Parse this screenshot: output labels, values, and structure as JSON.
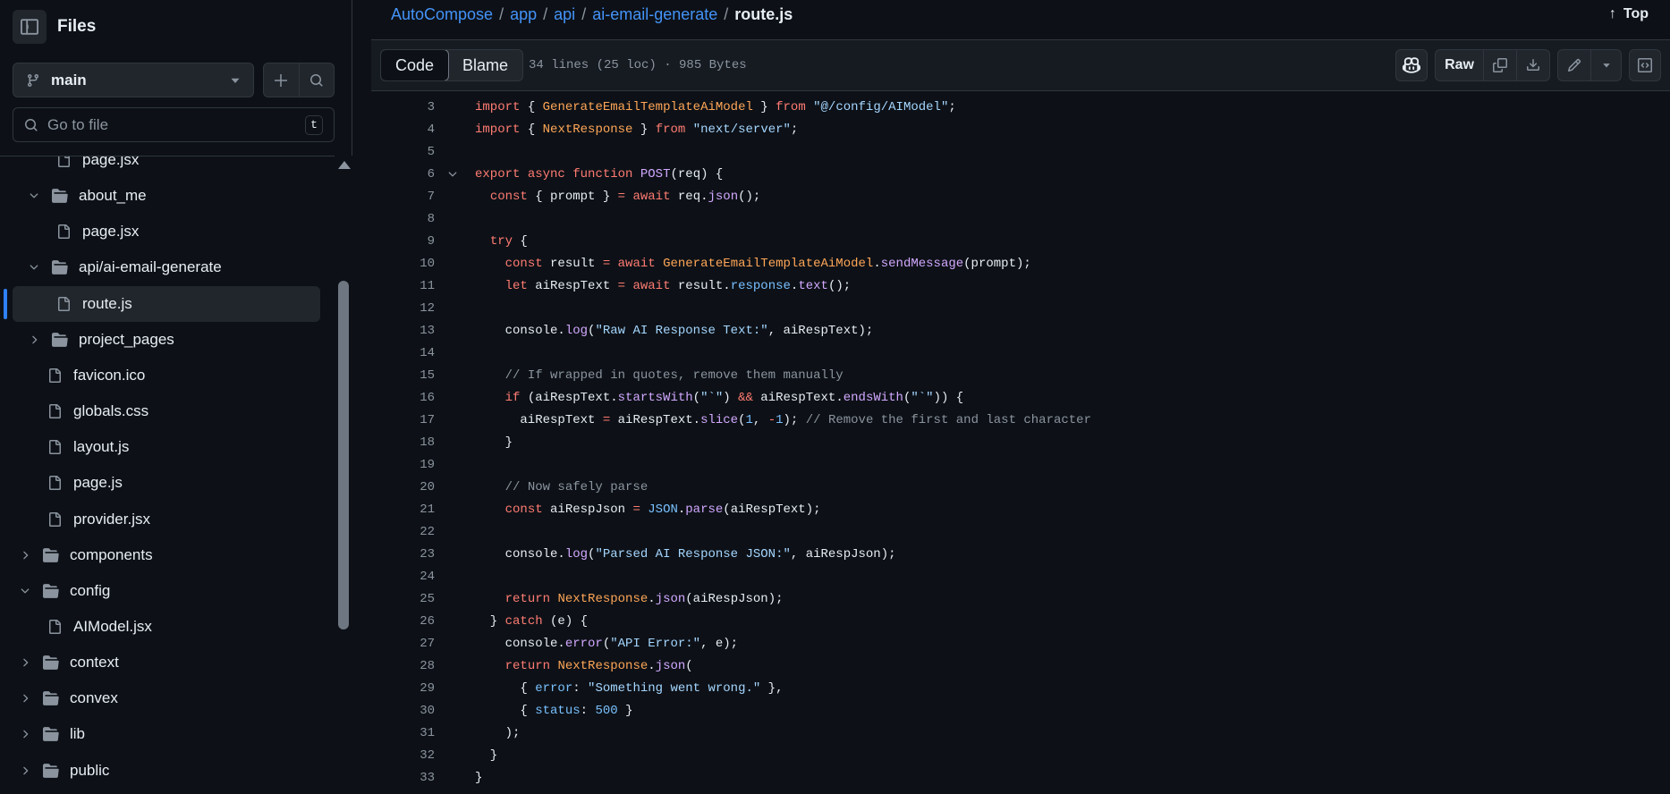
{
  "sidebar": {
    "title": "Files",
    "branch": "main",
    "search_placeholder": "Go to file",
    "search_shortcut": "t",
    "tree": [
      {
        "label": "page.jsx",
        "type": "file",
        "depth": 3
      },
      {
        "label": "about_me",
        "type": "folder-open",
        "depth": 2
      },
      {
        "label": "page.jsx",
        "type": "file",
        "depth": 3
      },
      {
        "label": "api/ai-email-generate",
        "type": "folder-open",
        "depth": 2
      },
      {
        "label": "route.js",
        "type": "file",
        "depth": 3,
        "active": true
      },
      {
        "label": "project_pages",
        "type": "folder-closed",
        "depth": 2
      },
      {
        "label": "favicon.ico",
        "type": "file",
        "depth": 2
      },
      {
        "label": "globals.css",
        "type": "file",
        "depth": 2
      },
      {
        "label": "layout.js",
        "type": "file",
        "depth": 2
      },
      {
        "label": "page.js",
        "type": "file",
        "depth": 2
      },
      {
        "label": "provider.jsx",
        "type": "file",
        "depth": 2
      },
      {
        "label": "components",
        "type": "folder-closed",
        "depth": 1
      },
      {
        "label": "config",
        "type": "folder-open",
        "depth": 1
      },
      {
        "label": "AIModel.jsx",
        "type": "file",
        "depth": 2
      },
      {
        "label": "context",
        "type": "folder-closed",
        "depth": 1
      },
      {
        "label": "convex",
        "type": "folder-closed",
        "depth": 1
      },
      {
        "label": "lib",
        "type": "folder-closed",
        "depth": 1
      },
      {
        "label": "public",
        "type": "folder-closed",
        "depth": 1
      }
    ]
  },
  "breadcrumb": {
    "repo": "AutoCompose",
    "parts": [
      "app",
      "api",
      "ai-email-generate"
    ],
    "current": "route.js",
    "top_label": "Top"
  },
  "file_header": {
    "tab_code": "Code",
    "tab_blame": "Blame",
    "meta": "34 lines (25 loc) · 985 Bytes",
    "raw_label": "Raw"
  },
  "code_lines": [
    {
      "n": "3",
      "html": "<span class=\"k\">import</span> { <span class=\"v\">GenerateEmailTemplateAiModel</span> } <span class=\"k\">from</span> <span class=\"s\">\"@/config/AIModel\"</span>;"
    },
    {
      "n": "4",
      "html": "<span class=\"k\">import</span> { <span class=\"v\">NextResponse</span> } <span class=\"k\">from</span> <span class=\"s\">\"next/server\"</span>;"
    },
    {
      "n": "5",
      "html": ""
    },
    {
      "n": "6",
      "fold": true,
      "html": "<span class=\"k\">export</span> <span class=\"k\">async</span> <span class=\"k\">function</span> <span class=\"f\">POST</span>(req) {"
    },
    {
      "n": "7",
      "html": "  <span class=\"k\">const</span> { prompt } <span class=\"k\">=</span> <span class=\"k\">await</span> req.<span class=\"f\">json</span>();"
    },
    {
      "n": "8",
      "html": ""
    },
    {
      "n": "9",
      "html": "  <span class=\"k\">try</span> {"
    },
    {
      "n": "10",
      "html": "    <span class=\"k\">const</span> result <span class=\"k\">=</span> <span class=\"k\">await</span> <span class=\"v\">GenerateEmailTemplateAiModel</span>.<span class=\"f\">sendMessage</span>(prompt);"
    },
    {
      "n": "11",
      "html": "    <span class=\"k\">let</span> aiRespText <span class=\"k\">=</span> <span class=\"k\">await</span> result.<span class=\"n\">response</span>.<span class=\"f\">text</span>();"
    },
    {
      "n": "12",
      "html": ""
    },
    {
      "n": "13",
      "html": "    console.<span class=\"f\">log</span>(<span class=\"s\">\"Raw AI Response Text:\"</span>, aiRespText);"
    },
    {
      "n": "14",
      "html": ""
    },
    {
      "n": "15",
      "html": "    <span class=\"c\">// If wrapped in quotes, remove them manually</span>"
    },
    {
      "n": "16",
      "html": "    <span class=\"k\">if</span> (aiRespText.<span class=\"f\">startsWith</span>(<span class=\"s\">\"`\"</span>) <span class=\"k\">&amp;&amp;</span> aiRespText.<span class=\"f\">endsWith</span>(<span class=\"s\">\"`\"</span>)) {"
    },
    {
      "n": "17",
      "html": "      aiRespText <span class=\"k\">=</span> aiRespText.<span class=\"f\">slice</span>(<span class=\"n\">1</span>, <span class=\"k\">-</span><span class=\"n\">1</span>); <span class=\"c\">// Remove the first and last character</span>"
    },
    {
      "n": "18",
      "html": "    }"
    },
    {
      "n": "19",
      "html": ""
    },
    {
      "n": "20",
      "html": "    <span class=\"c\">// Now safely parse</span>"
    },
    {
      "n": "21",
      "html": "    <span class=\"k\">const</span> aiRespJson <span class=\"k\">=</span> <span class=\"n\">JSON</span>.<span class=\"f\">parse</span>(aiRespText);"
    },
    {
      "n": "22",
      "html": ""
    },
    {
      "n": "23",
      "html": "    console.<span class=\"f\">log</span>(<span class=\"s\">\"Parsed AI Response JSON:\"</span>, aiRespJson);"
    },
    {
      "n": "24",
      "html": ""
    },
    {
      "n": "25",
      "html": "    <span class=\"k\">return</span> <span class=\"v\">NextResponse</span>.<span class=\"f\">json</span>(aiRespJson);"
    },
    {
      "n": "26",
      "html": "  } <span class=\"k\">catch</span> (e) {"
    },
    {
      "n": "27",
      "html": "    console.<span class=\"f\">error</span>(<span class=\"s\">\"API Error:\"</span>, e);"
    },
    {
      "n": "28",
      "html": "    <span class=\"k\">return</span> <span class=\"v\">NextResponse</span>.<span class=\"f\">json</span>("
    },
    {
      "n": "29",
      "html": "      { <span class=\"n\">error</span>: <span class=\"s\">\"Something went wrong.\"</span> },"
    },
    {
      "n": "30",
      "html": "      { <span class=\"n\">status</span>: <span class=\"n\">500</span> }"
    },
    {
      "n": "31",
      "html": "    );"
    },
    {
      "n": "32",
      "html": "  }"
    },
    {
      "n": "33",
      "html": "}"
    }
  ]
}
